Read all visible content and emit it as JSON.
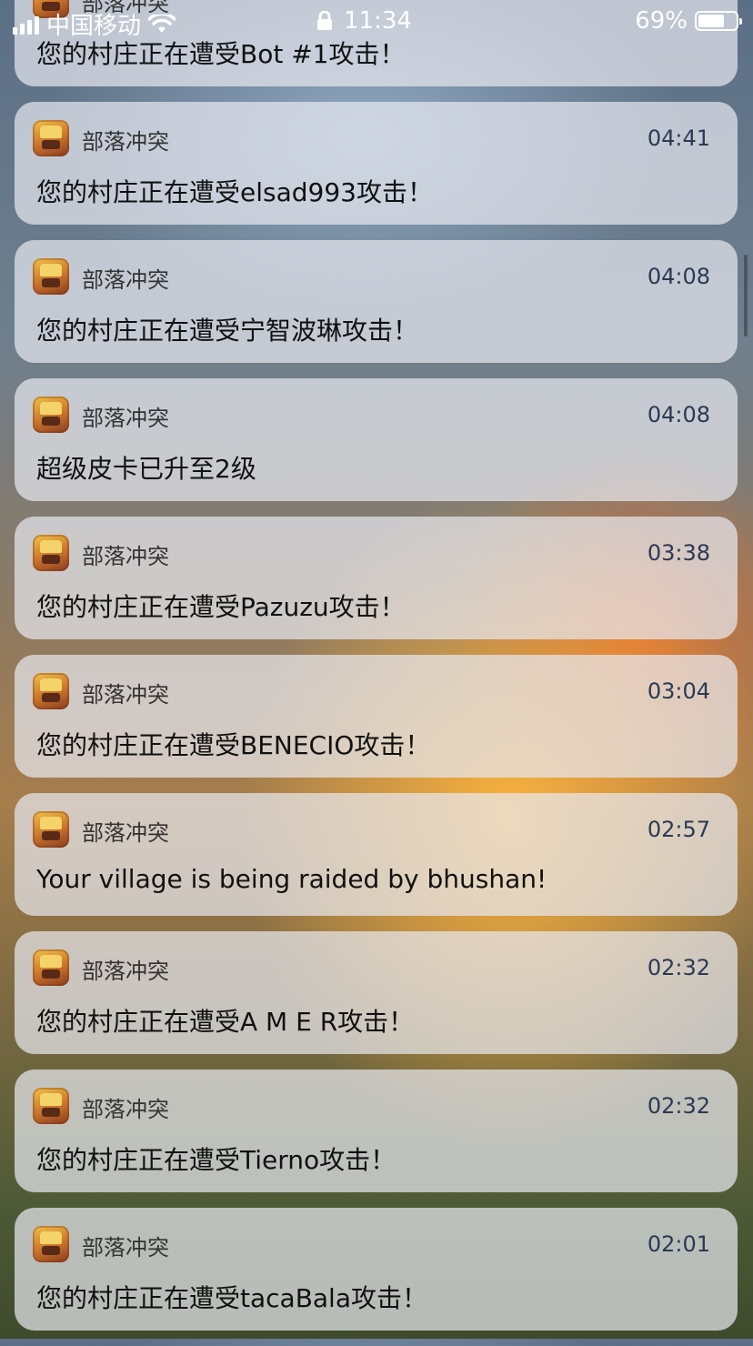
{
  "status_bar": {
    "carrier": "中国移动",
    "time": "11:34",
    "battery_percent": "69%",
    "battery_level": 0.69,
    "icons": [
      "signal-icon",
      "wifi-icon",
      "lock-icon",
      "battery-icon"
    ]
  },
  "app_name": "部落冲突",
  "notifications": [
    {
      "app": "部落冲突",
      "time": "",
      "message": "您的村庄正在遭受Bot #1攻击！"
    },
    {
      "app": "部落冲突",
      "time": "04:41",
      "message": "您的村庄正在遭受elsad993攻击！"
    },
    {
      "app": "部落冲突",
      "time": "04:08",
      "message": "您的村庄正在遭受宁智波琳攻击！"
    },
    {
      "app": "部落冲突",
      "time": "04:08",
      "message": "超级皮卡已升至2级"
    },
    {
      "app": "部落冲突",
      "time": "03:38",
      "message": "您的村庄正在遭受Pazuzu攻击！"
    },
    {
      "app": "部落冲突",
      "time": "03:04",
      "message": "您的村庄正在遭受BENECIO攻击！"
    },
    {
      "app": "部落冲突",
      "time": "02:57",
      "message": "Your village is being raided by bhushan!"
    },
    {
      "app": "部落冲突",
      "time": "02:32",
      "message": "您的村庄正在遭受A M E R攻击！"
    },
    {
      "app": "部落冲突",
      "time": "02:32",
      "message": "您的村庄正在遭受Tierno攻击！"
    },
    {
      "app": "部落冲突",
      "time": "02:01",
      "message": "您的村庄正在遭受tacaBala攻击！"
    }
  ]
}
